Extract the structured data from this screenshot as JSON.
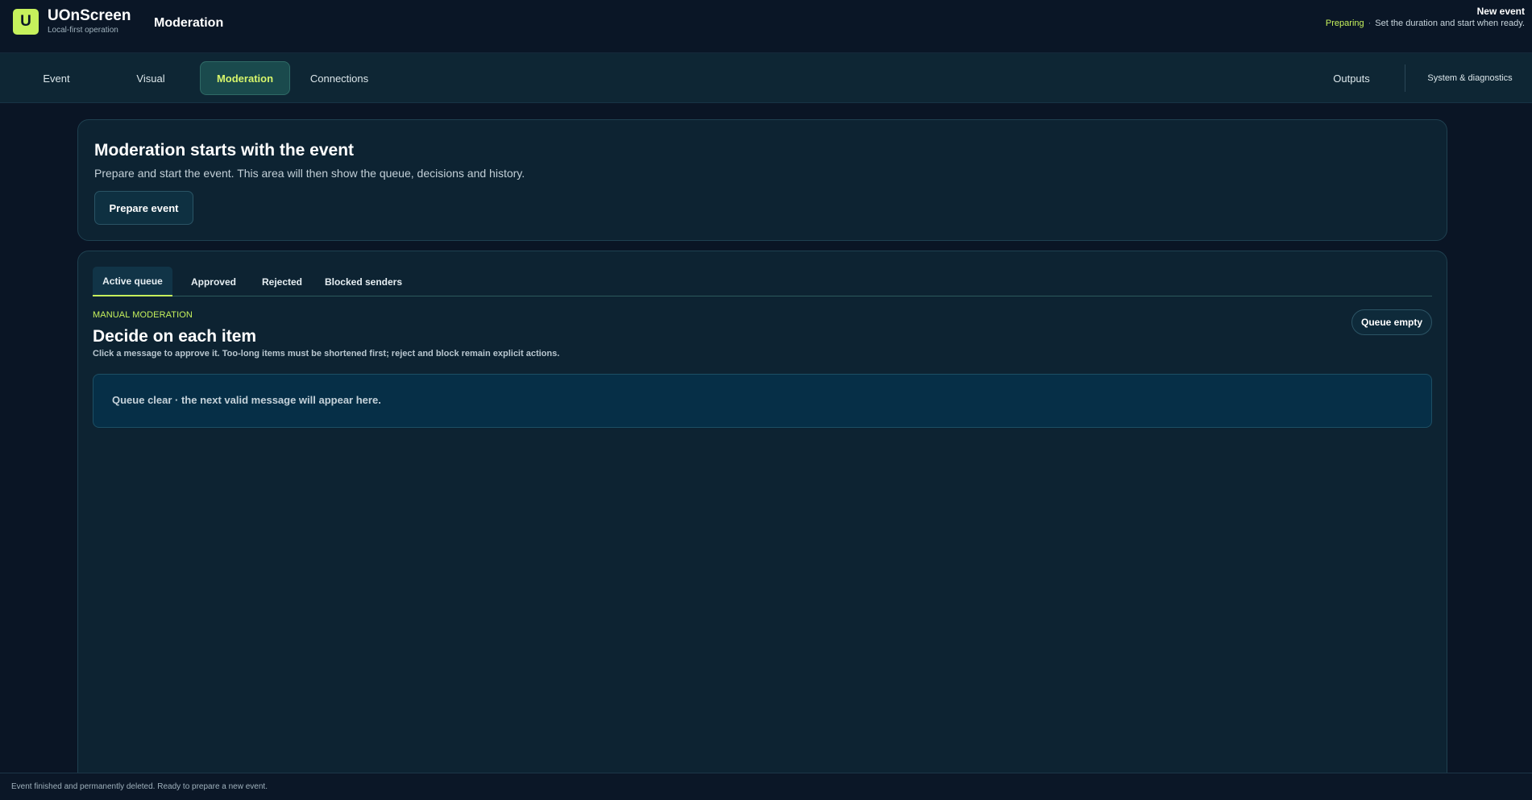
{
  "header": {
    "logo_letter": "U",
    "app_name": "UOnScreen",
    "tagline": "Local-first operation",
    "section_title": "Moderation",
    "event_name": "New event",
    "event_status": "Preparing",
    "event_hint": "Set the duration and start when ready."
  },
  "nav": {
    "tabs": [
      {
        "label": "Event"
      },
      {
        "label": "Visual"
      },
      {
        "label": "Moderation",
        "active": true
      },
      {
        "label": "Connections"
      }
    ],
    "right": [
      {
        "label": "Outputs"
      },
      {
        "label": "System & diagnostics"
      }
    ]
  },
  "banner": {
    "title": "Moderation starts with the event",
    "description": "Prepare and start the event. This area will then show the queue, decisions and history.",
    "button_label": "Prepare event"
  },
  "queue": {
    "tabs": [
      {
        "label": "Active queue",
        "active": true
      },
      {
        "label": "Approved"
      },
      {
        "label": "Rejected"
      },
      {
        "label": "Blocked senders"
      }
    ],
    "eyebrow": "MANUAL MODERATION",
    "title": "Decide on each item",
    "description": "Click a message to approve it. Too-long items must be shortened first; reject and block remain explicit actions.",
    "badge": "Queue empty",
    "empty_message": "Queue clear · the next valid message will appear here."
  },
  "footer": {
    "status": "Event finished and permanently deleted. Ready to prepare a new event."
  },
  "colors": {
    "accent": "#c6f15c",
    "background": "#0a1525",
    "panel": "#0d2332"
  }
}
